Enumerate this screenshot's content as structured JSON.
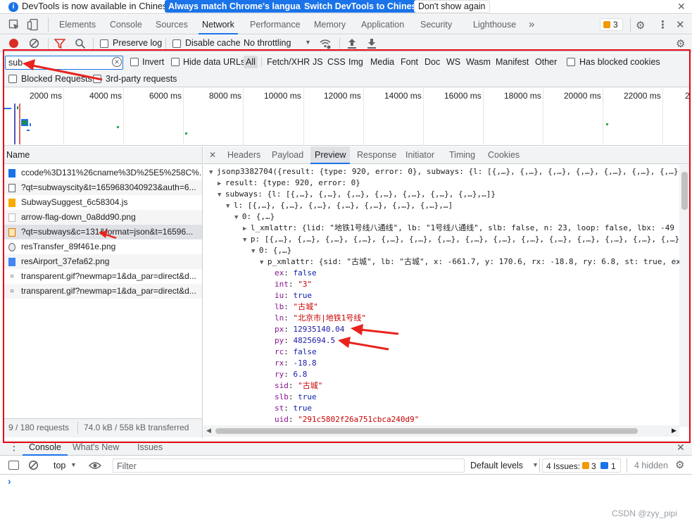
{
  "infobar": {
    "message": "DevTools is now available in Chinese!",
    "btn_match": "Always match Chrome's language",
    "btn_switch": "Switch DevTools to Chinese",
    "btn_dismiss": "Don't show again",
    "close": "✕"
  },
  "maintabs": [
    "Elements",
    "Console",
    "Sources",
    "Network",
    "Performance",
    "Memory",
    "Application",
    "Security",
    "Lighthouse"
  ],
  "more_tabs": "»",
  "issues_badge": "3",
  "toolbar": {
    "preserve_log": "Preserve log",
    "disable_cache": "Disable cache",
    "throttling": "No throttling"
  },
  "filter": {
    "value": "sub",
    "invert": "Invert",
    "hide_data_urls": "Hide data URLs",
    "types": [
      "All",
      "Fetch/XHR",
      "JS",
      "CSS",
      "Img",
      "Media",
      "Font",
      "Doc",
      "WS",
      "Wasm",
      "Manifest",
      "Other"
    ],
    "has_blocked_cookies": "Has blocked cookies",
    "blocked_requests": "Blocked Requests",
    "third_party": "3rd-party requests"
  },
  "overview": {
    "ticks": [
      "2000 ms",
      "4000 ms",
      "6000 ms",
      "8000 ms",
      "10000 ms",
      "12000 ms",
      "14000 ms",
      "16000 ms",
      "18000 ms",
      "20000 ms",
      "22000 ms",
      "2"
    ]
  },
  "requests": {
    "header": "Name",
    "rows": [
      {
        "name": "ccode%3D131%26cname%3D%25E5%258C%...",
        "icon": "script-doc-icon"
      },
      {
        "name": "?qt=subwayscity&t=1659683040923&auth=6...",
        "icon": "file-icon"
      },
      {
        "name": "SubwaySuggest_6c58304.js",
        "icon": "js-icon"
      },
      {
        "name": "arrow-flag-down_0a8dd90.png",
        "icon": "image-icon"
      },
      {
        "name": "?qt=subways&c=131&format=json&t=16596...",
        "icon": "js-icon"
      },
      {
        "name": "resTransfer_89f461e.png",
        "icon": "image-icon"
      },
      {
        "name": "resAirport_37efa62.png",
        "icon": "image-icon"
      },
      {
        "name": "transparent.gif?newmap=1&da_par=direct&d...",
        "icon": "image-icon"
      },
      {
        "name": "transparent.gif?newmap=1&da_par=direct&d...",
        "icon": "image-icon"
      }
    ],
    "status_requests": "9 / 180 requests",
    "status_transferred": "74.0 kB / 558 kB transferred"
  },
  "detail": {
    "close": "✕",
    "tabs": [
      "Headers",
      "Payload",
      "Preview",
      "Response",
      "Initiator",
      "Timing",
      "Cookies"
    ],
    "active_tab": "Preview",
    "lines": [
      "jsonp3382704({result: {type: 920, error: 0}, subways: {l: [{,…}, {,…}, {,…}, {,…}, {,…}, {,…}, {,…},",
      "result: {type: 920, error: 0}",
      "subways: {l: [{,…}, {,…}, {,…}, {,…}, {,…}, {,…}, {,…},…]}",
      "l: [{,…}, {,…}, {,…}, {,…}, {,…}, {,…}, {,…},…]",
      "0: {,…}",
      "l_xmlattr: {lid: \"地铁1号线八通线\", lb: \"1号线八通线\", slb: false, n: 23, loop: false, lbx: -49",
      "p: [{,…}, {,…}, {,…}, {,…}, {,…}, {,…}, {,…}, {,…}, {,…}, {,…}, {,…}, {,…}, {,…}, {,…}, {,…},",
      "0: {,…}",
      "p_xmlattr: {sid: \"古城\", lb: \"古城\", x: -661.7, y: 170.6, rx: -18.8, ry: 6.8, st: true, ex"
    ],
    "props": [
      {
        "key": "ex",
        "value": "false",
        "kind": "kw"
      },
      {
        "key": "int",
        "value": "\"3\"",
        "kind": "s"
      },
      {
        "key": "iu",
        "value": "true",
        "kind": "kw"
      },
      {
        "key": "lb",
        "value": "\"古城\"",
        "kind": "s"
      },
      {
        "key": "ln",
        "value": "\"北京市|地铁1号线\"",
        "kind": "s"
      },
      {
        "key": "px",
        "value": "12935140.04",
        "kind": "n"
      },
      {
        "key": "py",
        "value": "4825694.5",
        "kind": "n"
      },
      {
        "key": "rc",
        "value": "false",
        "kind": "kw"
      },
      {
        "key": "rx",
        "value": "-18.8",
        "kind": "n"
      },
      {
        "key": "ry",
        "value": "6.8",
        "kind": "n"
      },
      {
        "key": "sid",
        "value": "\"古城\"",
        "kind": "s"
      },
      {
        "key": "slb",
        "value": "true",
        "kind": "kw"
      },
      {
        "key": "st",
        "value": "true",
        "kind": "kw"
      },
      {
        "key": "uid",
        "value": "\"291c5802f26a751cbca240d9\"",
        "kind": "s"
      }
    ]
  },
  "drawer": {
    "tabs": [
      "Console",
      "What's New",
      "Issues"
    ],
    "context": "top",
    "filter_placeholder": "Filter",
    "levels": "Default levels",
    "issues_label": "4 Issues:",
    "issues_warn": "3",
    "issues_info": "1",
    "hidden": "4 hidden",
    "prompt": "›",
    "close": "✕"
  },
  "watermark": "CSDN @zyy_pipi",
  "colors": {
    "accent": "#1a73e8",
    "annotation_red": "#e60012"
  }
}
